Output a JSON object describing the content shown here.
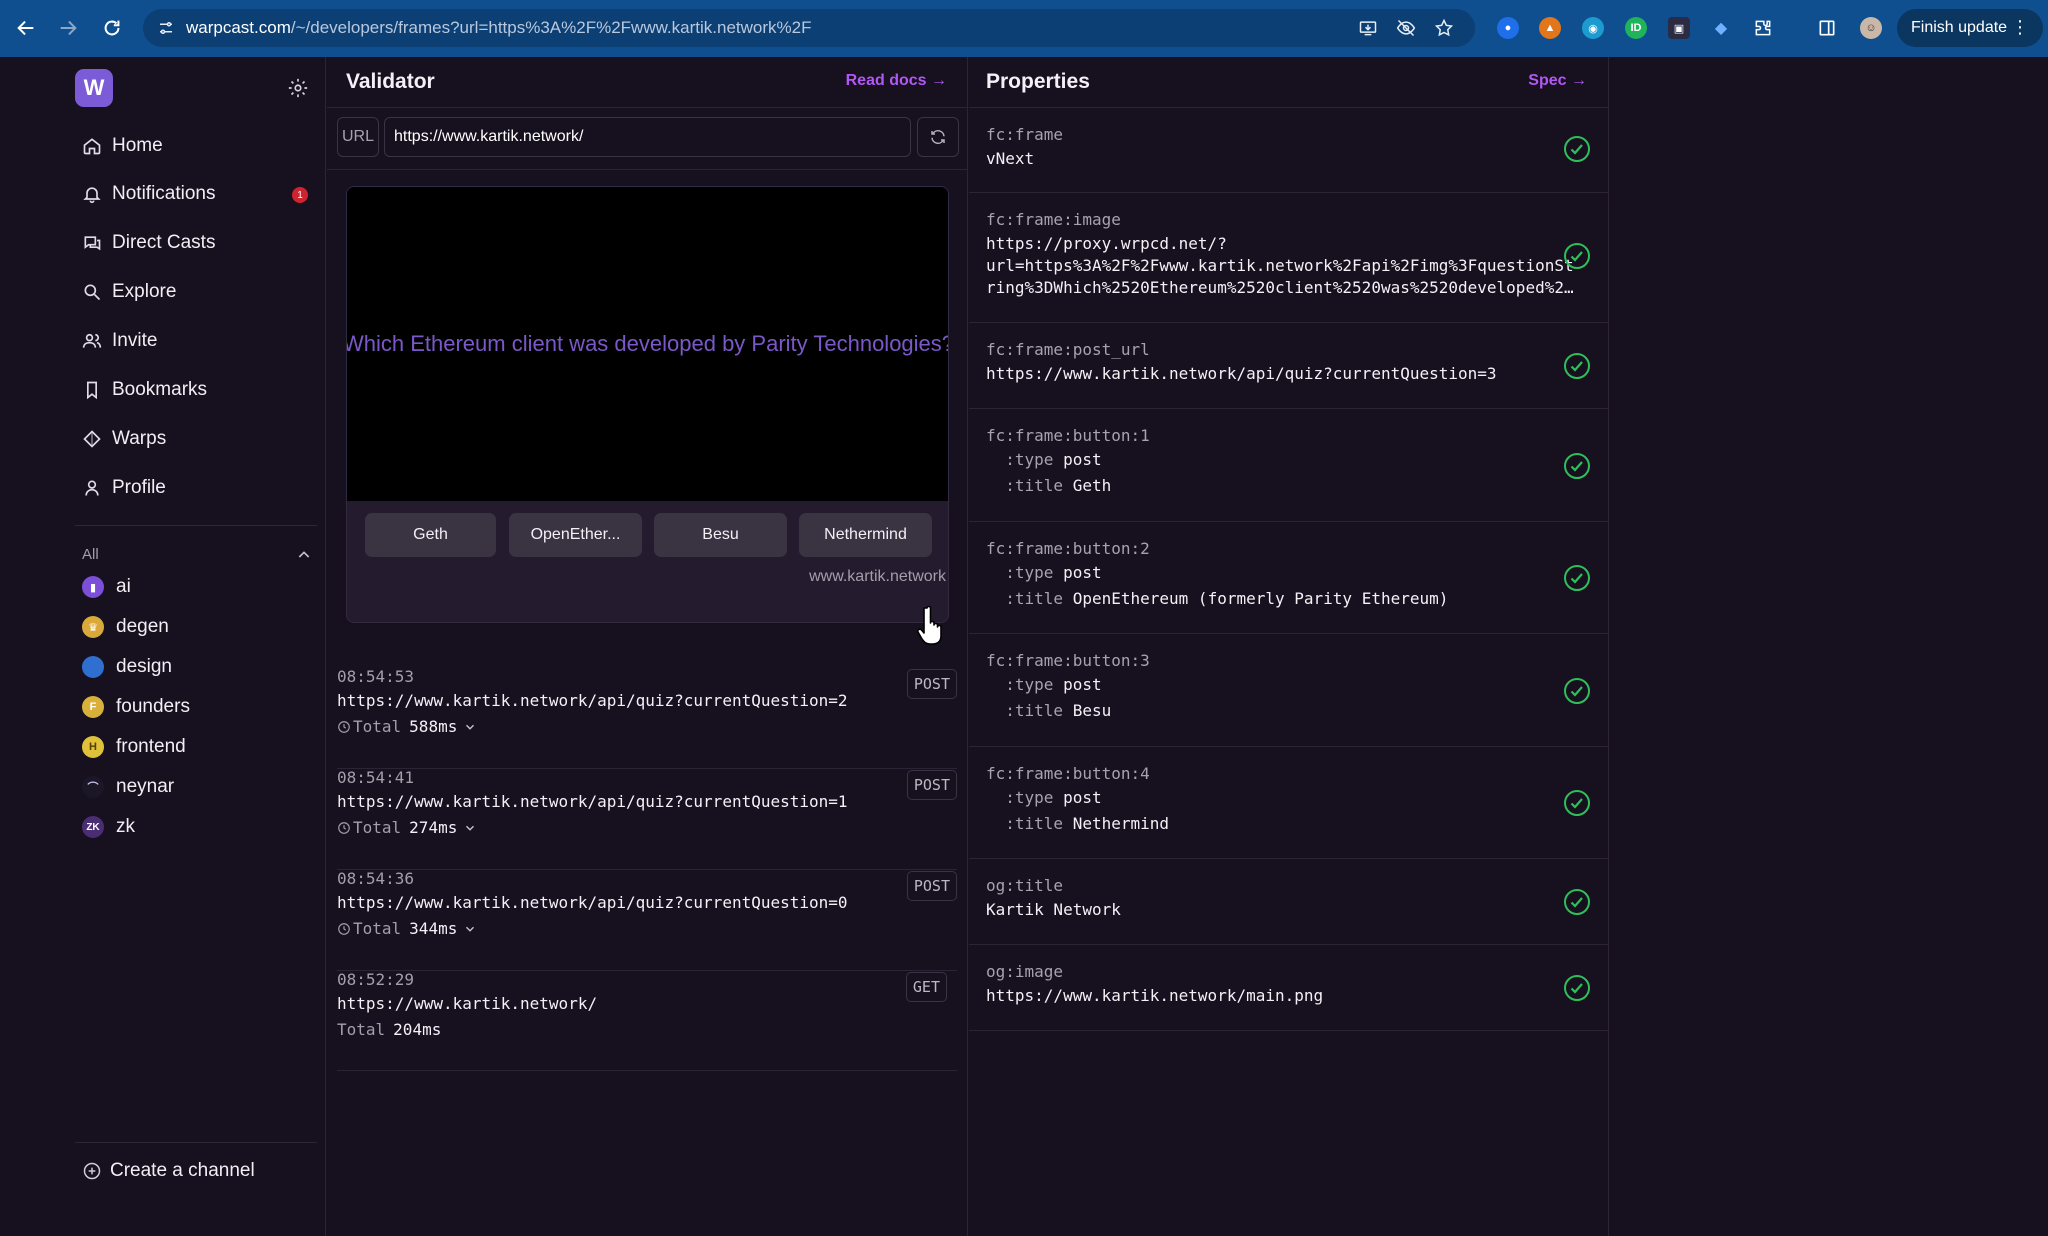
{
  "browser": {
    "url_host": "warpcast.com",
    "url_path": "/~/developers/frames?url=https%3A%2F%2Fwww.kartik.network%2F",
    "finish_update": "Finish update"
  },
  "sidebar": {
    "logo": "W",
    "nav": [
      {
        "label": "Home",
        "icon": "home-icon"
      },
      {
        "label": "Notifications",
        "icon": "bell-icon"
      },
      {
        "label": "Direct Casts",
        "icon": "chat-icon"
      },
      {
        "label": "Explore",
        "icon": "search-icon"
      },
      {
        "label": "Invite",
        "icon": "users-icon"
      },
      {
        "label": "Bookmarks",
        "icon": "bookmark-icon"
      },
      {
        "label": "Warps",
        "icon": "diamond-icon"
      },
      {
        "label": "Profile",
        "icon": "user-icon"
      }
    ],
    "notification_count": "1",
    "channels_label": "All",
    "channels": [
      {
        "name": "ai",
        "color": "#7b4fd8"
      },
      {
        "name": "degen",
        "color": "#d9a93a"
      },
      {
        "name": "design",
        "color": "#2f6fd0"
      },
      {
        "name": "founders",
        "color": "#d9b13a"
      },
      {
        "name": "frontend",
        "color": "#e0c23a"
      },
      {
        "name": "neynar",
        "color": "#1c1726"
      },
      {
        "name": "zk",
        "color": "#4b2d73"
      }
    ],
    "create_channel": "Create a channel"
  },
  "validator": {
    "title": "Validator",
    "read_docs": "Read docs",
    "url_label": "URL",
    "url_value": "https://www.kartik.network/",
    "frame": {
      "question": "Which Ethereum client was developed by Parity Technologies?",
      "buttons": [
        "Geth",
        "OpenEther...",
        "Besu",
        "Nethermind"
      ],
      "domain": "www.kartik.network"
    },
    "log": [
      {
        "time": "08:54:53",
        "url": "https://www.kartik.network/api/quiz?currentQuestion=2",
        "total_label": "Total",
        "total": "588ms",
        "method": "POST",
        "expandable": true
      },
      {
        "time": "08:54:41",
        "url": "https://www.kartik.network/api/quiz?currentQuestion=1",
        "total_label": "Total",
        "total": "274ms",
        "method": "POST",
        "expandable": true
      },
      {
        "time": "08:54:36",
        "url": "https://www.kartik.network/api/quiz?currentQuestion=0",
        "total_label": "Total",
        "total": "344ms",
        "method": "POST",
        "expandable": true
      },
      {
        "time": "08:52:29",
        "url": "https://www.kartik.network/",
        "total_label": "Total",
        "total": "204ms",
        "method": "GET",
        "expandable": false
      }
    ]
  },
  "properties": {
    "title": "Properties",
    "spec": "Spec",
    "rows": [
      {
        "key": "fc:frame",
        "value": "vNext"
      },
      {
        "key": "fc:frame:image",
        "value": "https://proxy.wrpcd.net/?\nurl=https%3A%2F%2Fwww.kartik.network%2Fapi%2Fimg%3FquestionSt\nring%3DWhich%2520Ethereum%2520client%2520was%2520developed%2…"
      },
      {
        "key": "fc:frame:post_url",
        "value": "https://www.kartik.network/api/quiz?currentQuestion=3"
      },
      {
        "key": "fc:frame:button:1",
        "type_label": ":type",
        "type": "post",
        "title_label": ":title",
        "title": "Geth"
      },
      {
        "key": "fc:frame:button:2",
        "type_label": ":type",
        "type": "post",
        "title_label": ":title",
        "title": "OpenEthereum (formerly Parity Ethereum)"
      },
      {
        "key": "fc:frame:button:3",
        "type_label": ":type",
        "type": "post",
        "title_label": ":title",
        "title": "Besu"
      },
      {
        "key": "fc:frame:button:4",
        "type_label": ":type",
        "type": "post",
        "title_label": ":title",
        "title": "Nethermind"
      },
      {
        "key": "og:title",
        "value": "Kartik Network"
      },
      {
        "key": "og:image",
        "value": "https://www.kartik.network/main.png"
      }
    ]
  },
  "colors": {
    "accent": "#b158f4",
    "valid": "#2fbf5a",
    "badge": "#d0232e"
  }
}
